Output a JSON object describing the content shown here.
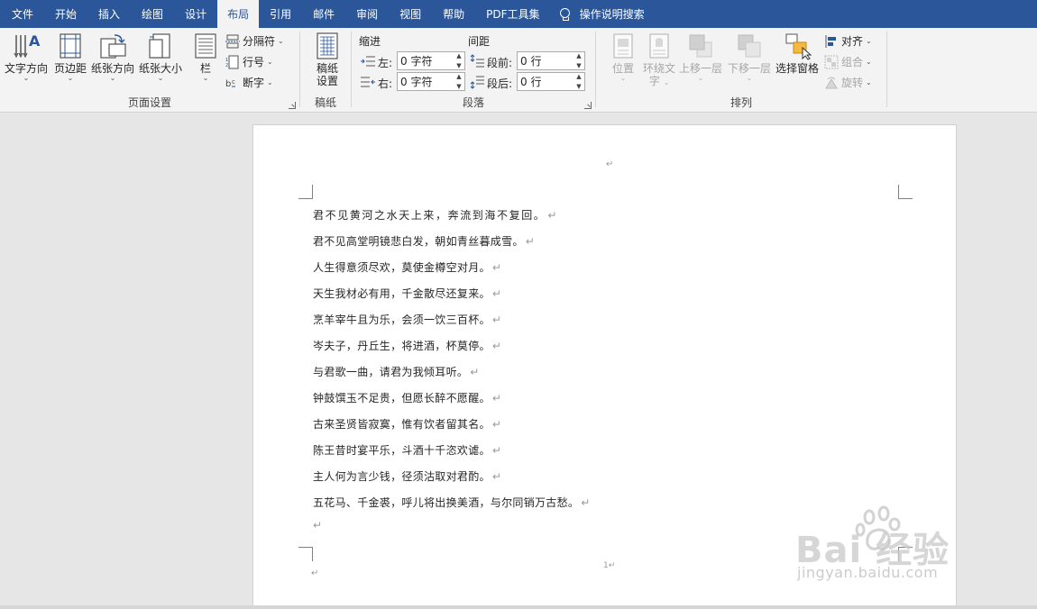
{
  "tabs": [
    {
      "label": "文件",
      "active": false
    },
    {
      "label": "开始",
      "active": false
    },
    {
      "label": "插入",
      "active": false
    },
    {
      "label": "绘图",
      "active": false
    },
    {
      "label": "设计",
      "active": false
    },
    {
      "label": "布局",
      "active": true
    },
    {
      "label": "引用",
      "active": false
    },
    {
      "label": "邮件",
      "active": false
    },
    {
      "label": "审阅",
      "active": false
    },
    {
      "label": "视图",
      "active": false
    },
    {
      "label": "帮助",
      "active": false
    },
    {
      "label": "PDF工具集",
      "active": false
    }
  ],
  "tell_me": "操作说明搜索",
  "page_setup": {
    "group_label": "页面设置",
    "text_direction": "文字方向",
    "margins": "页边距",
    "orientation": "纸张方向",
    "size": "纸张大小",
    "columns": "栏",
    "breaks": "分隔符",
    "line_numbers": "行号",
    "hyphenation": "断字"
  },
  "manuscript": {
    "group_label": "稿纸",
    "button_line1": "稿纸",
    "button_line2": "设置"
  },
  "paragraph": {
    "group_label": "段落",
    "indent_header": "缩进",
    "spacing_header": "间距",
    "left_label": "左:",
    "right_label": "右:",
    "before_label": "段前:",
    "after_label": "段后:",
    "left_value": "0 字符",
    "right_value": "0 字符",
    "before_value": "0 行",
    "after_value": "0 行"
  },
  "arrange": {
    "group_label": "排列",
    "position": "位置",
    "wrap_line1": "环绕文",
    "wrap_line2": "字",
    "bring_forward": "上移一层",
    "send_backward": "下移一层",
    "selection_pane": "选择窗格",
    "align": "对齐",
    "group": "组合",
    "rotate": "旋转"
  },
  "document": {
    "pilcrow": "↵",
    "page_number": "1",
    "lines": [
      "君不见黄河之水天上来，奔流到海不复回。",
      "君不见高堂明镜悲白发，朝如青丝暮成雪。",
      "人生得意须尽欢，莫使金樽空对月。",
      "天生我材必有用，千金散尽还复来。",
      "烹羊宰牛且为乐，会须一饮三百杯。",
      "岑夫子，丹丘生，将进酒，杯莫停。",
      "与君歌一曲，请君为我倾耳听。",
      "钟鼓馔玉不足贵，但愿长醉不愿醒。",
      "古来圣贤皆寂寞，惟有饮者留其名。",
      "陈王昔时宴平乐，斗酒十千恣欢谑。",
      "主人何为言少钱，径须沽取对君酌。",
      "五花马、千金裘，呼儿将出换美酒，与尔同销万古愁。"
    ]
  },
  "watermark": {
    "brand": "Bai 经验",
    "url": "jingyan.baidu.com"
  }
}
